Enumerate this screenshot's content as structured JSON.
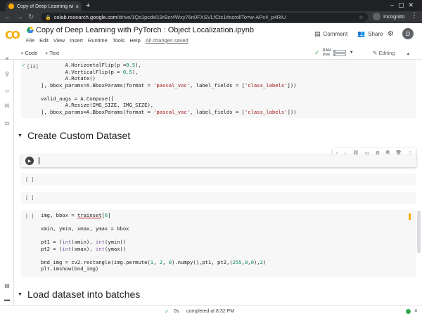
{
  "browser": {
    "tab_title": "Copy of Deep Learning wi",
    "tab_close": "×",
    "new_tab": "+",
    "url_host": "colab.research.google.com",
    "url_path": "/drive/1Qs1pcdxl19rBcr4Wxy76n0FXSVLfCtc1#scrollTo=w-APc4_p4RiU",
    "profile": "Incognito"
  },
  "colab": {
    "logo": "CO",
    "title": "Copy of Deep Learning with PyTorch : Object Localization.ipynb",
    "menus": [
      "File",
      "Edit",
      "View",
      "Insert",
      "Runtime",
      "Tools",
      "Help"
    ],
    "saved_status": "All changes saved",
    "comment": "Comment",
    "share": "Share",
    "avatar": "D"
  },
  "toolbar": {
    "add_code": "+ Code",
    "add_text": "+ Text",
    "ram": "RAM",
    "disk": "Disk",
    "ram_level": 0.15,
    "disk_level": 0.15,
    "editing": "Editing"
  },
  "cells": {
    "cell13_prompt": "[13]",
    "cell13_lines": [
      "        A.HorizontalFlip(p =0.5),",
      "        A.VerticalFlip(p = 0.5),",
      "        A.Rotate()",
      "], bbox_params=A.BboxParams(format = 'pascal_voc', label_fields = ['class_labels']))",
      "",
      "valid_augs = A.Compose([",
      "        A.Resize(IMG_SIZE, IMG_SIZE),",
      "], bbox_params=A.BboxParams(format = 'pascal_voc', label_fields = ['class_labels']))"
    ],
    "section1": "Create Custom Dataset",
    "empty_prompt1": "[ ]",
    "empty_prompt2": "[ ]",
    "cell3_prompt": "[ ]",
    "cell3_lines": [
      "img, bbox = trainset[6]",
      "",
      "xmin, ymin, xmax, ymax = bbox",
      "",
      "pt1 = (int(xmin), int(ymin))",
      "pt2 = (int(xmax), int(ymax))",
      "",
      "bnd_img = cv2.rectangle(img.permute(1, 2, 0).numpy(),pt1, pt2,(255,0,0),2)",
      "plt.imshow(bnd_img)"
    ],
    "section2": "Load dataset into batches"
  },
  "status": {
    "check": "✓",
    "duration": "0s",
    "message": "completed at 8:32 PM"
  },
  "colors": {
    "accent": "#f9ab00",
    "ok": "#34a853"
  }
}
